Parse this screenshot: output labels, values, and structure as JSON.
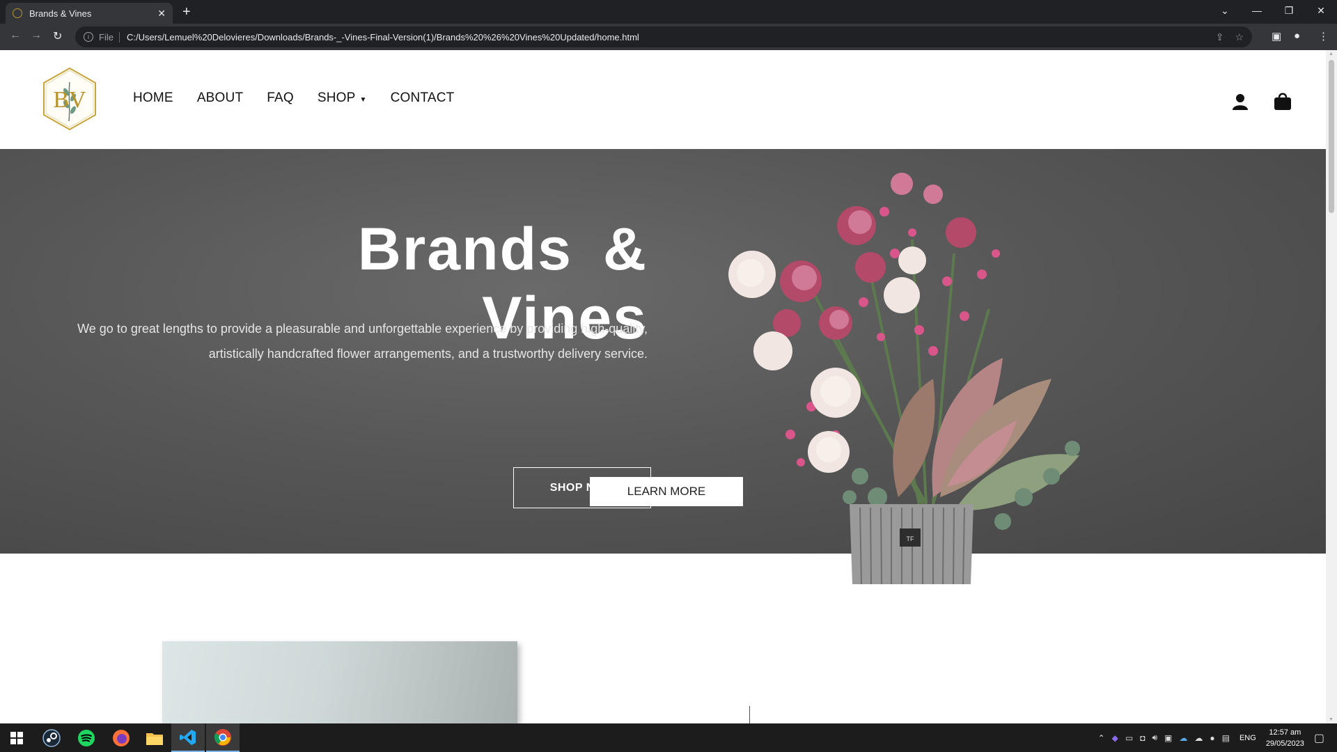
{
  "browser": {
    "tab_title": "Brands & Vines",
    "file_label": "File",
    "url": "C:/Users/Lemuel%20Delovieres/Downloads/Brands-_-Vines-Final-Version(1)/Brands%20%26%20Vines%20Updated/home.html"
  },
  "site": {
    "logo_text": "BV",
    "nav": {
      "home": "HOME",
      "about": "ABOUT",
      "faq": "FAQ",
      "shop": "SHOP",
      "contact": "CONTACT"
    }
  },
  "hero": {
    "title": "Brands  &  Vines",
    "text": "We go to great lengths to provide a pleasurable and unforgettable experience by providing high-quality, artistically handcrafted flower arrangements, and a trustworthy delivery service.",
    "cta": "SHOP NOW",
    "learn_more": "LEARN MORE",
    "vase_label": "TF"
  },
  "taskbar": {
    "lang": "ENG",
    "time": "12:57 am",
    "date": "29/05/2023"
  },
  "colors": {
    "hero_bg": "#575757",
    "logo_gold": "#c9a43a",
    "chrome_dark": "#202124"
  }
}
